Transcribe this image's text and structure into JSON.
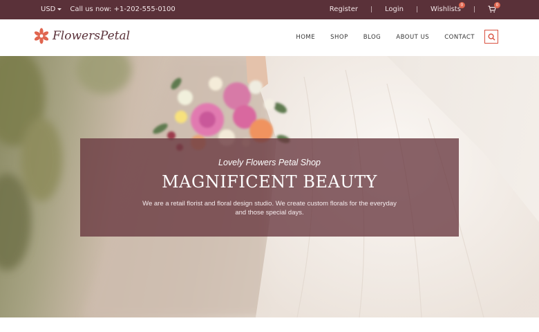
{
  "topbar": {
    "currency": "USD",
    "phone": "Call us now: +1-202-555-0100",
    "register": "Register",
    "login": "Login",
    "wishlists": "Wishlists",
    "wishlist_count": "0",
    "cart_count": "0",
    "separator": "|"
  },
  "header": {
    "logo_text": "FlowersPetal",
    "nav": [
      "HOME",
      "SHOP",
      "BLOG",
      "ABOUT US",
      "CONTACT"
    ]
  },
  "hero": {
    "subtitle": "Lovely Flowers Petal Shop",
    "title": "MAGNIFICENT BEAUTY",
    "description": "We are a retail florist and floral design studio. We create custom florals for the everyday and those special days."
  },
  "colors": {
    "topbar_bg": "#5a3139",
    "accent": "#d9503f",
    "overlay": "#68373f"
  },
  "icons": [
    "flower-logo-icon",
    "cart-icon",
    "search-icon",
    "caret-down-icon"
  ]
}
